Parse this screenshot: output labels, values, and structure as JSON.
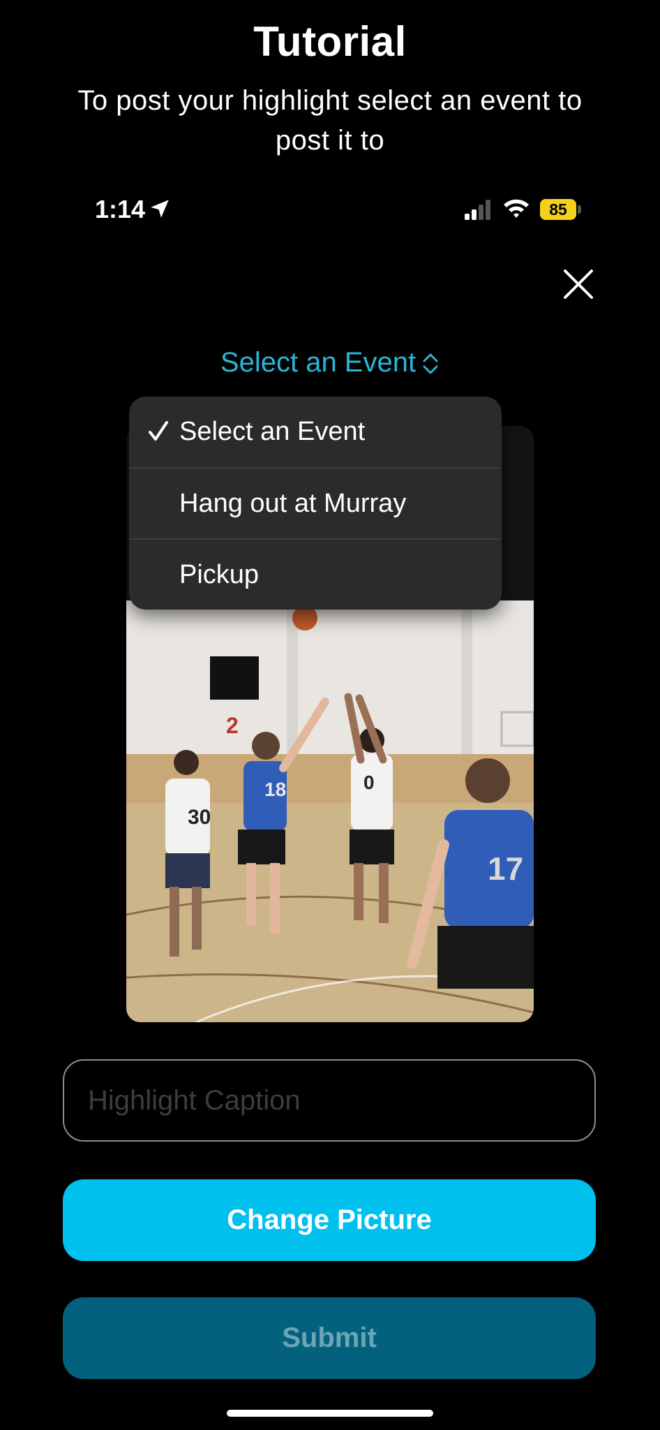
{
  "tutorial": {
    "title": "Tutorial",
    "description": "To post your highlight select an event to post it to"
  },
  "status_bar": {
    "time": "1:14",
    "battery": "85",
    "icons": [
      "location-arrow-icon",
      "signal-icon",
      "wifi-icon",
      "battery-icon"
    ]
  },
  "header": {
    "close_icon": "close-icon"
  },
  "event_picker": {
    "selected_label": "Select an Event",
    "accent_color": "#2ab6d9",
    "options": [
      {
        "label": "Select an Event",
        "checked": true
      },
      {
        "label": "Hang out at Murray",
        "checked": false
      },
      {
        "label": "Pickup",
        "checked": false
      }
    ]
  },
  "photo": {
    "scoreboard_number": "2",
    "jersey_numbers": [
      "30",
      "18",
      "0",
      "17"
    ]
  },
  "form": {
    "caption_placeholder": "Highlight Caption",
    "caption_value": "",
    "change_picture_label": "Change Picture",
    "submit_label": "Submit",
    "primary_color": "#00c0ee",
    "disabled_color": "#04617e"
  }
}
